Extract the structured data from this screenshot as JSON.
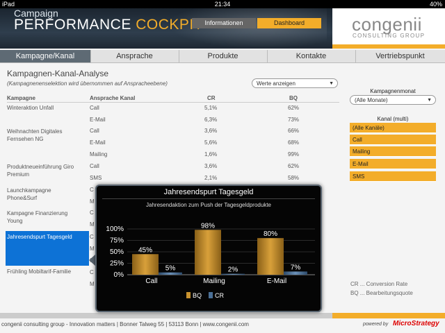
{
  "status": {
    "device": "iPad",
    "time": "21:34",
    "battery": "40%"
  },
  "header": {
    "brand_small": "Campaign",
    "brand_big_1": "PERFORMANCE",
    "brand_big_2": "COCKPIT",
    "btn_info": "Informationen",
    "btn_dashboard": "Dashboard",
    "logo_name": "congenii",
    "logo_sub": "CONSULTING GROUP"
  },
  "tabs": [
    "Kampagne/Kanal",
    "Ansprache",
    "Produkte",
    "Kontakte",
    "Vertriebspunkt"
  ],
  "main": {
    "title": "Kampagnen-Kanal-Analyse",
    "subtitle": "(Kampagnenenselektion wird übernommen auf Anspracheebene)",
    "select_werte": "Werte anzeigen",
    "columns": [
      "Kampagne",
      "Ansprache Kanal",
      "CR",
      "BQ"
    ],
    "campaigns": [
      "Winteraktion Unfall",
      "Weihnachten Digitales Fernsehen NG",
      "Produktneueinführung Giro Premium",
      "Launchkampagne Phone&Surf",
      "Kampagne Finanzierung Young",
      "Jahresendspurt Tagesgeld",
      "Frühling Mobiltarif-Familie"
    ],
    "rows": [
      {
        "channel": "Call",
        "cr": "5,1%",
        "bq": "62%"
      },
      {
        "channel": "E-Mail",
        "cr": "6,3%",
        "bq": "73%"
      },
      {
        "channel": "Call",
        "cr": "3,6%",
        "bq": "66%"
      },
      {
        "channel": "E-Mail",
        "cr": "5,6%",
        "bq": "68%"
      },
      {
        "channel": "Mailing",
        "cr": "1,6%",
        "bq": "99%"
      },
      {
        "channel": "Call",
        "cr": "3,6%",
        "bq": "62%"
      },
      {
        "channel": "SMS",
        "cr": "2,1%",
        "bq": "58%"
      }
    ],
    "hidden_channel_initials": [
      "C",
      "M",
      "C",
      "M",
      "C",
      "M",
      "S",
      "C",
      "M"
    ]
  },
  "right": {
    "monat_label": "Kampagnenmonat",
    "monat_value": "(Alle Monate)",
    "kanal_label": "Kanal (multi)",
    "kanal_items": [
      "(Alle Kanäle)",
      "Call",
      "Mailing",
      "E-Mail",
      "SMS"
    ],
    "def_cr": "CR ... Conversion Rate",
    "def_bq": "BQ ... Bearbeitungsquote"
  },
  "footer": {
    "text": "congenii consulting group - Innovation matters | Bonner Talweg 55 | 53113 Bonn | www.congenii.com",
    "powered": "powered by",
    "vendor": "MicroStrategy"
  },
  "popup": {
    "title": "Jahresendspurt Tagesgeld",
    "subtitle": "Jahresendaktion zum Push der Tagesgeldprodukte"
  },
  "chart_data": {
    "type": "bar",
    "categories": [
      "Call",
      "Mailing",
      "E-Mail"
    ],
    "series": [
      {
        "name": "BQ",
        "values": [
          45,
          98,
          80
        ],
        "labels": [
          "45%",
          "98%",
          "80%"
        ],
        "color": "#c8922e"
      },
      {
        "name": "CR",
        "values": [
          5,
          2,
          7
        ],
        "labels": [
          "5%",
          "2%",
          "7%"
        ],
        "color": "#4a6f96"
      }
    ],
    "ylim": [
      0,
      100
    ],
    "yticks": [
      "0%",
      "25%",
      "50%",
      "75%",
      "100%"
    ],
    "legend": "bottom-center"
  }
}
